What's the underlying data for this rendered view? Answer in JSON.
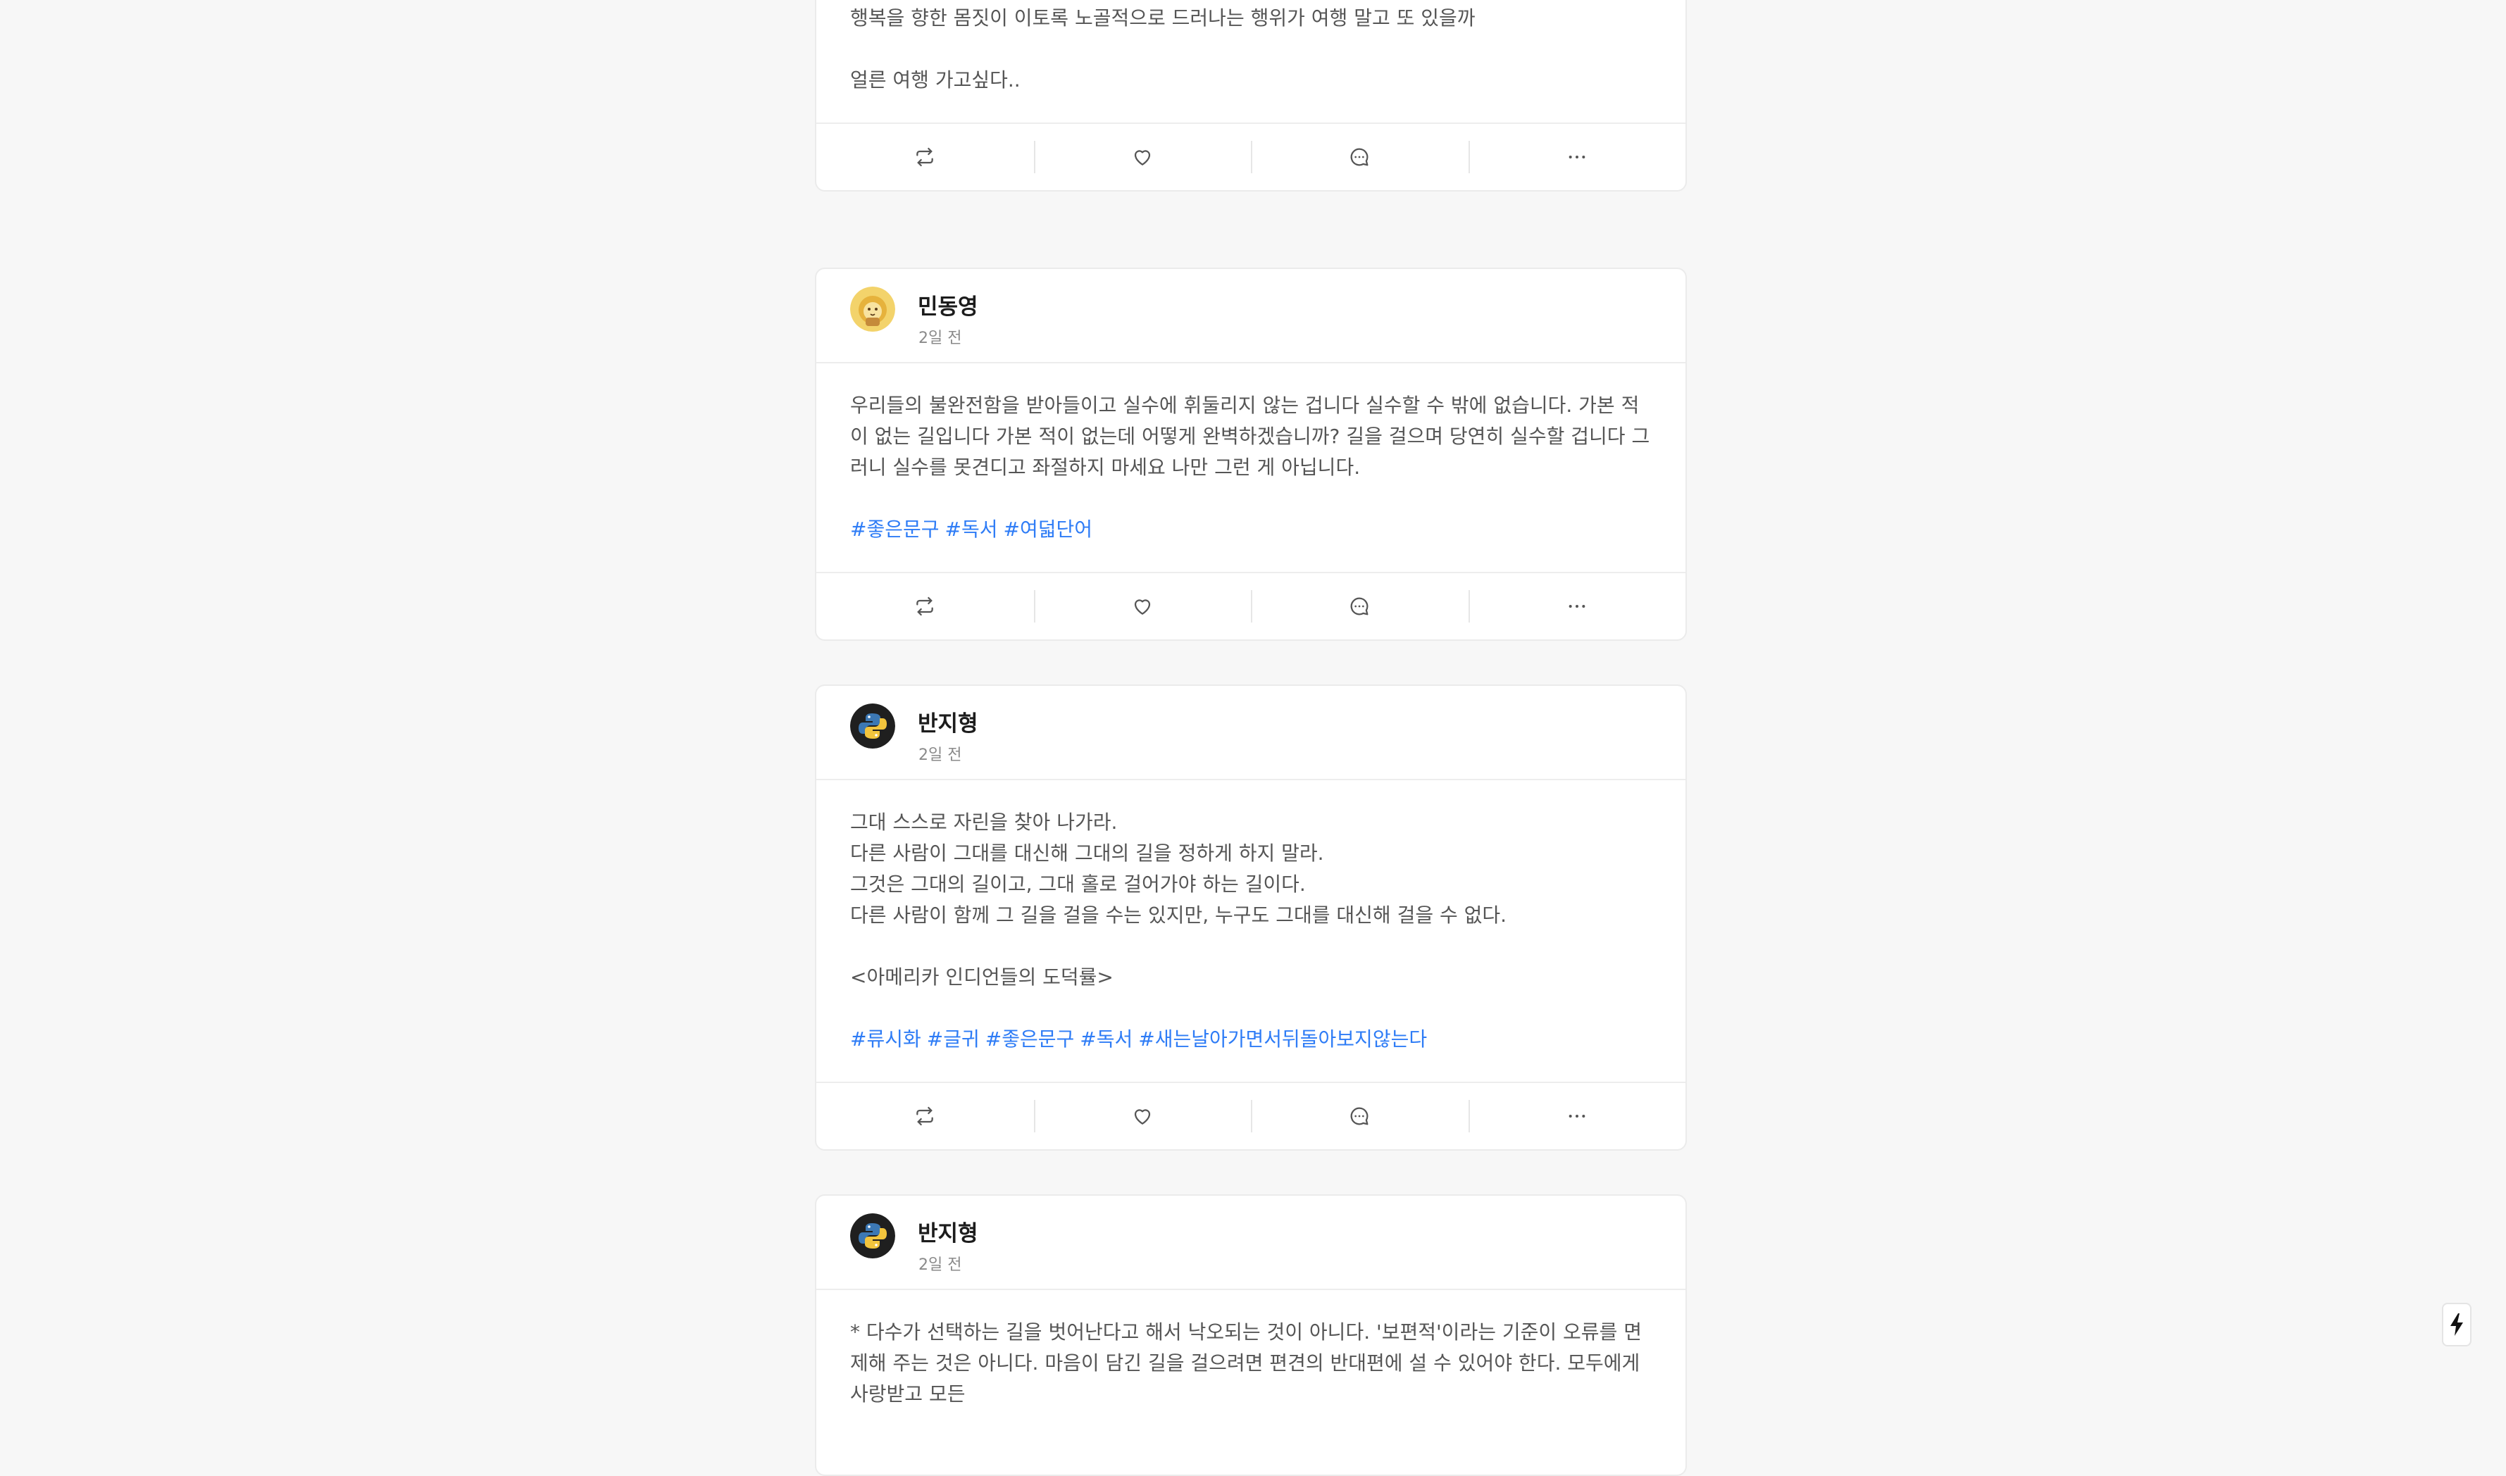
{
  "posts": [
    {
      "author": "",
      "time": "",
      "lines": [
        "행복을 향한 몸짓이 이토록 노골적으로 드러나는 행위가 여행 말고 또 있을까",
        "",
        "얼른 여행 가고싶다.."
      ],
      "tags": []
    },
    {
      "author": "민동영",
      "time": "2일 전",
      "lines": [
        "우리들의 불완전함을 받아들이고 실수에 휘둘리지 않는 겁니다 실수할 수 밖에 없습니다. 가본 적이 없는 길입니다 가본 적이 없는데 어떻게 완벽하겠습니까? 길을 걸으며 당연히 실수할 겁니다 그러니 실수를 못견디고 좌절하지 마세요 나만 그런 게 아닙니다.",
        ""
      ],
      "tags": [
        "#좋은문구",
        "#독서",
        "#여덟단어"
      ]
    },
    {
      "author": "반지형",
      "time": "2일 전",
      "lines": [
        "그대 스스로 자린을 찾아 나가라.",
        "다른 사람이 그대를 대신해 그대의 길을 정하게 하지 말라.",
        "그것은 그대의 길이고, 그대 홀로 걸어가야 하는 길이다.",
        "다른 사람이 함께 그 길을 걸을 수는 있지만, 누구도 그대를 대신해 걸을 수 없다.",
        "",
        "<아메리카 인디언들의 도덕률>",
        ""
      ],
      "tags": [
        "#류시화",
        "#글귀",
        "#좋은문구",
        "#독서",
        "#새는날아가면서뒤돌아보지않는다"
      ]
    },
    {
      "author": "반지형",
      "time": "2일 전",
      "lines": [
        "* 다수가 선택하는 길을 벗어난다고 해서 낙오되는 것이 아니다. '보편적'이라는 기준이 오류를 면제해 주는 것은 아니다. 마음이 담긴 길을 걸으려면 편견의 반대편에 설 수 있어야 한다. 모두에게 사랑받고 모든"
      ],
      "tags": []
    }
  ],
  "actions": {
    "repost": "repost-icon",
    "like": "heart-icon",
    "comment": "comment-icon",
    "more": "more-icon"
  },
  "colors": {
    "background": "#f7f7f7",
    "tag": "#2e7cf6",
    "text": "#555555"
  }
}
